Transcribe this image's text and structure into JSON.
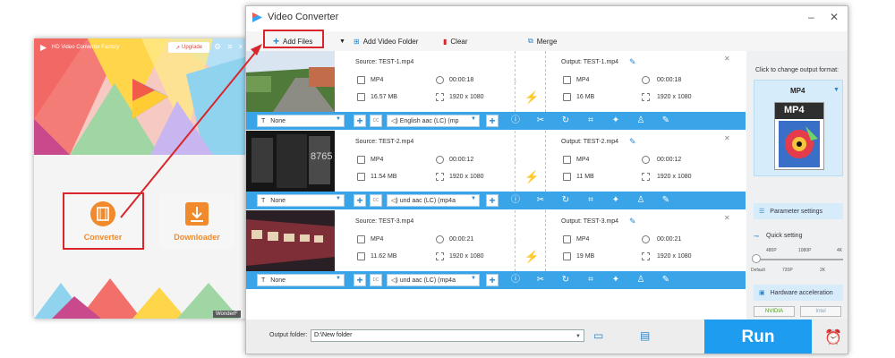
{
  "home": {
    "title": "HD Video Converter Factory",
    "upgrade_label": "Upgrade",
    "converter_label": "Converter",
    "downloader_label": "Downloader",
    "badge": "WonderF"
  },
  "converter": {
    "title": "Video Converter",
    "toolbar": {
      "add_files": "Add Files",
      "add_video_folder": "Add Video Folder",
      "clear": "Clear",
      "merge": "Merge"
    },
    "files": [
      {
        "source": "Source: TEST-1.mp4",
        "src_format": "MP4",
        "src_duration": "00:00:18",
        "src_size": "16.57 MB",
        "src_res": "1920 x 1080",
        "output": "Output: TEST-1.mp4",
        "out_format": "MP4",
        "out_duration": "00:00:18",
        "out_size": "16 MB",
        "out_res": "1920 x 1080",
        "subtitle": "None",
        "audio": "English aac (LC) (mp"
      },
      {
        "source": "Source: TEST-2.mp4",
        "src_format": "MP4",
        "src_duration": "00:00:12",
        "src_size": "11.54 MB",
        "src_res": "1920 x 1080",
        "output": "Output: TEST-2.mp4",
        "out_format": "MP4",
        "out_duration": "00:00:12",
        "out_size": "11 MB",
        "out_res": "1920 x 1080",
        "subtitle": "None",
        "audio": "und aac (LC) (mp4a"
      },
      {
        "source": "Source: TEST-3.mp4",
        "src_format": "MP4",
        "src_duration": "00:00:21",
        "src_size": "11.62 MB",
        "src_res": "1920 x 1080",
        "output": "Output: TEST-3.mp4",
        "out_format": "MP4",
        "out_duration": "00:00:21",
        "out_size": "19 MB",
        "out_res": "1920 x 1080",
        "subtitle": "None",
        "audio": "und aac (LC) (mp4a"
      }
    ],
    "right_panel": {
      "hint": "Click to change output format:",
      "format": "MP4",
      "format_icon_text": "MP4",
      "parameter_settings": "Parameter settings",
      "quick_setting": "Quick setting",
      "scale_top": [
        "480P",
        "1080P",
        "4K"
      ],
      "scale_bottom": [
        "Default",
        "720P",
        "2K"
      ],
      "hardware_acceleration": "Hardware acceleration",
      "nvidia": "NVIDIA",
      "intel": "Intel"
    },
    "bottom": {
      "output_folder_label": "Output folder:",
      "output_folder_value": "D:\\New folder",
      "run_label": "Run"
    },
    "colors": {
      "accent_blue": "#1e9df0",
      "highlight_red": "#d8262c",
      "converter_orange": "#f08a2c"
    }
  }
}
